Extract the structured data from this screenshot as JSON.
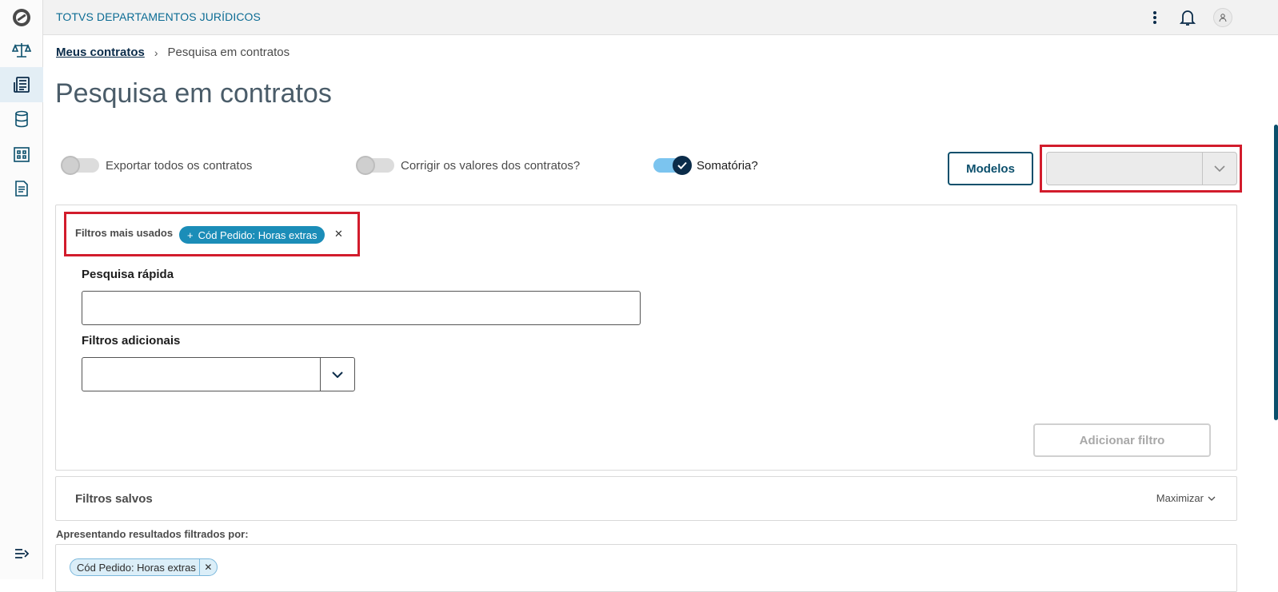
{
  "app": {
    "title": "TOTVS DEPARTAMENTOS JURÍDICOS"
  },
  "sidebar": {
    "items": [
      {
        "icon": "totvs-logo-icon"
      },
      {
        "icon": "scale-icon"
      },
      {
        "icon": "contracts-icon",
        "active": true
      },
      {
        "icon": "database-icon"
      },
      {
        "icon": "building-icon"
      },
      {
        "icon": "document-icon"
      }
    ],
    "collapse_icon": "collapse-menu-icon"
  },
  "topbar": {
    "icons": [
      "more-options-icon",
      "notification-bell-icon",
      "user-avatar-icon"
    ]
  },
  "breadcrumb": {
    "link": "Meus contratos",
    "current": "Pesquisa em contratos"
  },
  "page": {
    "title": "Pesquisa em contratos"
  },
  "toggles": [
    {
      "label": "Exportar todos os contratos",
      "checked": false
    },
    {
      "label": "Corrigir os valores dos contratos?",
      "checked": false
    },
    {
      "label": "Somatória?",
      "checked": true
    }
  ],
  "actions": {
    "modelos_label": "Modelos",
    "modelos_select_value": ""
  },
  "filters": {
    "most_used_label": "Filtros mais usados",
    "most_used_chips": [
      "Cód Pedido: Horas extras"
    ],
    "quick_search_label": "Pesquisa rápida",
    "quick_search_value": "",
    "additional_label": "Filtros adicionais",
    "additional_value": "",
    "add_filter_label": "Adicionar filtro"
  },
  "saved_filters": {
    "title": "Filtros salvos",
    "maximize_label": "Maximizar"
  },
  "results": {
    "label": "Apresentando resultados filtrados por:",
    "chips": [
      "Cód Pedido: Horas extras"
    ]
  },
  "colors": {
    "accent": "#0b4f6c",
    "chip": "#1b8db8",
    "highlight": "#d21c2c",
    "toggle_on": "#7bc4ef"
  }
}
